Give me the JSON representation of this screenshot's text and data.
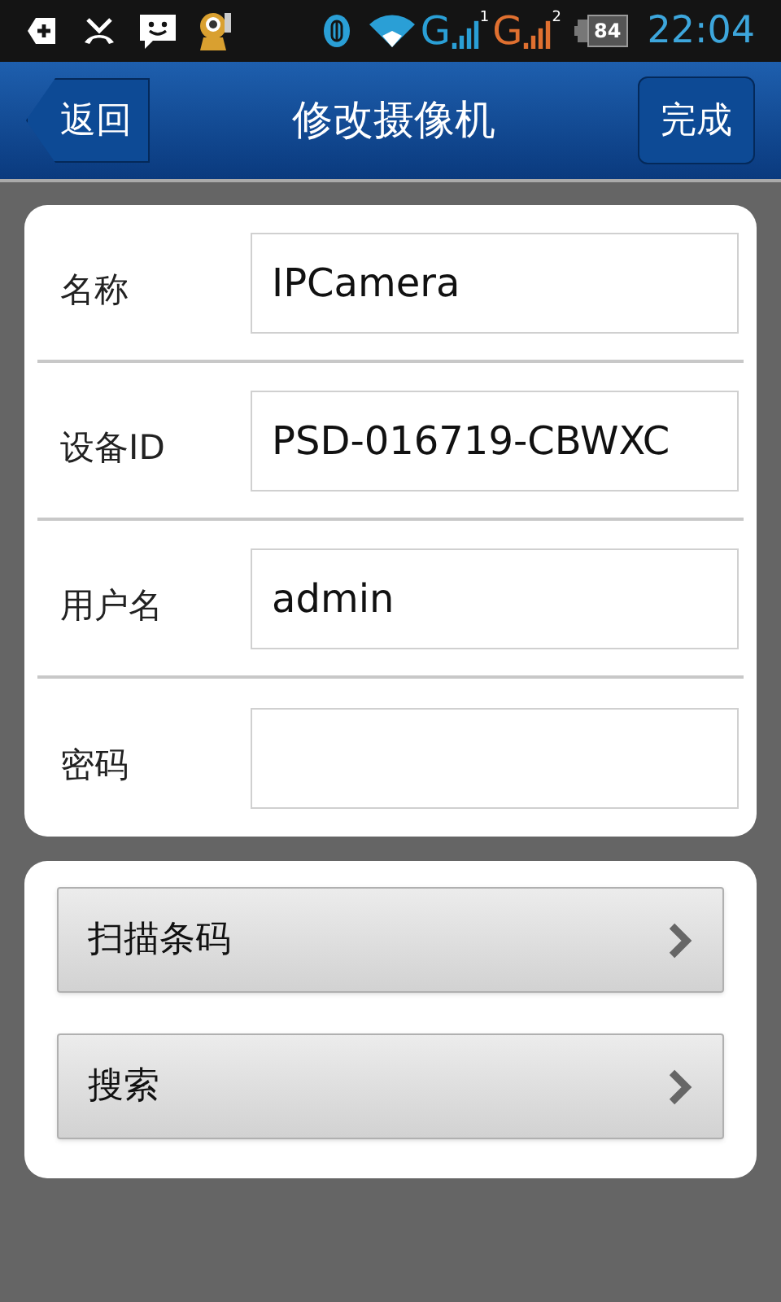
{
  "status_bar": {
    "battery": "84",
    "time": "22:04",
    "networks": [
      {
        "label": "G",
        "sim": "1",
        "color": "#2a9fd6"
      },
      {
        "label": "G",
        "sim": "2",
        "color": "#e07030"
      }
    ]
  },
  "header": {
    "back": "返回",
    "title": "修改摄像机",
    "done": "完成"
  },
  "form": [
    {
      "label": "名称",
      "value": "IPCamera"
    },
    {
      "label": "设备ID",
      "value": "PSD-016719-CBWXC"
    },
    {
      "label": "用户名",
      "value": "admin"
    },
    {
      "label": "密码"
    }
  ],
  "actions": [
    {
      "label": "扫描条码"
    },
    {
      "label": "搜索"
    }
  ]
}
